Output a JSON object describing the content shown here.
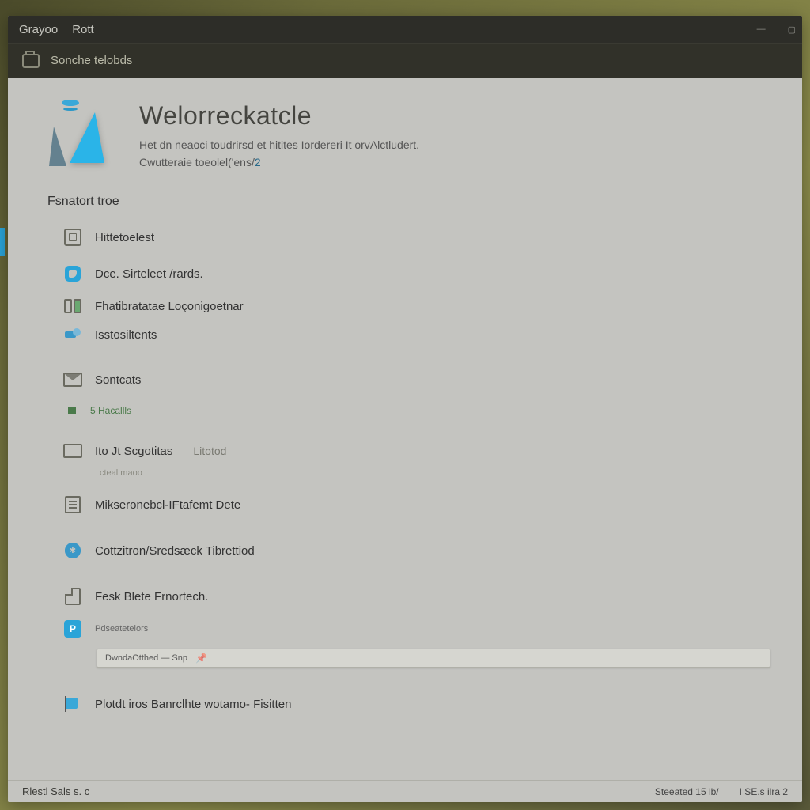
{
  "titlebar": {
    "app": "Grayoo",
    "doc": "Rott"
  },
  "toolbar": {
    "label": "Sonche telobds"
  },
  "hero": {
    "title": "Welorreckatcle",
    "line1": "Het dn neaoci toudrirsd et hitites Iordereri It orvAlctludert.",
    "line2a": "Cwutteraie toeolel('ens/",
    "line2b": "2"
  },
  "section": "Fsnatort troe",
  "items": [
    {
      "icon": "box",
      "label": "Hittetoelest"
    },
    {
      "icon": "ring",
      "label": "Dce. Sirteleet /rards."
    },
    {
      "icon": "double",
      "label": "Fhatibratatae Loçonigoetnar"
    },
    {
      "icon": "pin",
      "label": "Isstosiltents"
    },
    {
      "icon": "env",
      "label": "Sontcats"
    },
    {
      "icon": "sq",
      "label": "5 Hacallls",
      "sub": true
    },
    {
      "icon": "rect",
      "label": "Ito Jt Scgotitas",
      "meta": "Litotod"
    },
    {
      "icon": "",
      "label": "cteal  maoo",
      "caption": true
    },
    {
      "icon": "page",
      "label": "Mikseronebcl-IFtafemt Dete"
    },
    {
      "icon": "gear",
      "label": "Cottzitron/Sredsæck Tibrettiod"
    },
    {
      "icon": "doc",
      "label": "Fesk Blete Frnortech."
    }
  ],
  "chip": {
    "top": "Pdseatetelors",
    "bottom": "DwndaOtthed — Snp"
  },
  "lastitem": {
    "label": "Plotdt iros Banrclhte wotamo- Fisitten"
  },
  "status": {
    "left": "Rlestl Sals s. c",
    "right1": "Steeated  15   lb/",
    "right2": "I SE.s ilra 2"
  }
}
